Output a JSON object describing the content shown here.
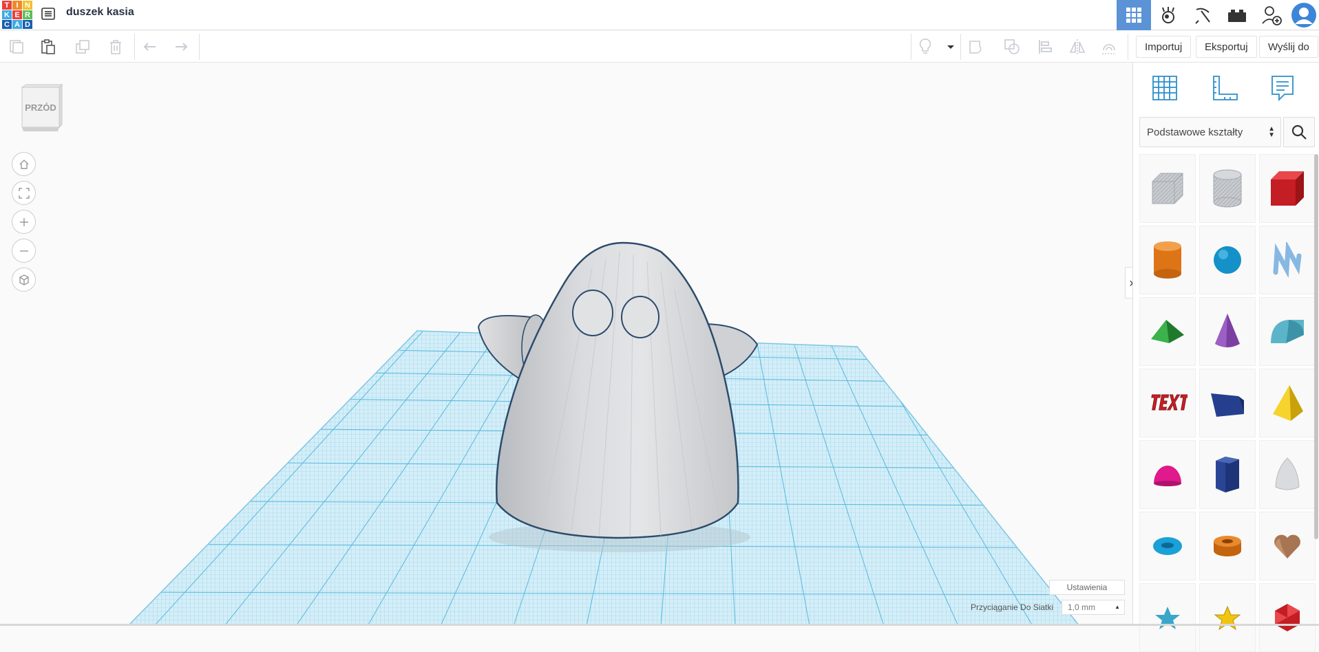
{
  "app": {
    "logo_letters": [
      {
        "ch": "T",
        "color": "#e8413a"
      },
      {
        "ch": "I",
        "color": "#ef8a2b"
      },
      {
        "ch": "N",
        "color": "#f3c02f"
      },
      {
        "ch": "K",
        "color": "#3fa9e0"
      },
      {
        "ch": "E",
        "color": "#e8413a"
      },
      {
        "ch": "R",
        "color": "#5dbf58"
      },
      {
        "ch": "C",
        "color": "#1a5fb4"
      },
      {
        "ch": "A",
        "color": "#3fa9e0"
      },
      {
        "ch": "D",
        "color": "#1a5fb4"
      }
    ],
    "project_title": "duszek kasia",
    "accent": "#5b93d6"
  },
  "topbar": {
    "icons": [
      "grid-view-icon",
      "simulation-icon",
      "pickaxe-icon",
      "bricks-icon",
      "add-user-icon",
      "user-avatar-icon"
    ]
  },
  "toolbar": {
    "left_icons": [
      "new-shape-icon",
      "paste-icon",
      "duplicate-icon",
      "delete-icon",
      "undo-icon",
      "redo-icon"
    ],
    "right_icons": [
      "light-bulb-icon",
      "dropdown-icon",
      "group-icon",
      "ungroup-icon",
      "align-icon",
      "mirror-icon",
      "cruise-icon"
    ],
    "import_label": "Importuj",
    "export_label": "Eksportuj",
    "send_label": "Wyślij do"
  },
  "workplane": {
    "viewcube_label": "PRZÓD",
    "view_controls": [
      "home-view-icon",
      "fit-view-icon",
      "zoom-in-icon",
      "zoom-out-icon",
      "ortho-view-icon"
    ],
    "settings_label": "Ustawienia",
    "snap_label": "Przyciąganie Do Siatki",
    "snap_value": "1,0 mm",
    "grid_color": "#66c4e2"
  },
  "right_panel": {
    "tabs": [
      "workplane-grid-icon",
      "ruler-icon",
      "notes-icon"
    ],
    "category": "Podstawowe kształty",
    "shapes": [
      {
        "name": "box-hole",
        "color": "#b8bcc2"
      },
      {
        "name": "cylinder-hole",
        "color": "#c4c8ce"
      },
      {
        "name": "box",
        "color": "#d42127"
      },
      {
        "name": "cylinder",
        "color": "#e67e22"
      },
      {
        "name": "sphere",
        "color": "#1a9fd6"
      },
      {
        "name": "scribble",
        "color": "#7fb4e0"
      },
      {
        "name": "roof",
        "color": "#2e9e3a"
      },
      {
        "name": "cone",
        "color": "#7b3fa1"
      },
      {
        "name": "round-roof",
        "color": "#5fb6cc"
      },
      {
        "name": "text",
        "color": "#c91f26"
      },
      {
        "name": "wedge",
        "color": "#253f8e"
      },
      {
        "name": "pyramid",
        "color": "#f1c40f"
      },
      {
        "name": "half-sphere",
        "color": "#e0198c"
      },
      {
        "name": "polygon",
        "color": "#2b4596"
      },
      {
        "name": "paraboloid",
        "color": "#d5d7da"
      },
      {
        "name": "torus",
        "color": "#1ba0d8"
      },
      {
        "name": "tube",
        "color": "#e67e22"
      },
      {
        "name": "heart",
        "color": "#9c6b48"
      },
      {
        "name": "star",
        "color": "#3aa6c9"
      },
      {
        "name": "star-yellow",
        "color": "#f1c40f"
      },
      {
        "name": "icosahedron",
        "color": "#d42127"
      }
    ]
  }
}
